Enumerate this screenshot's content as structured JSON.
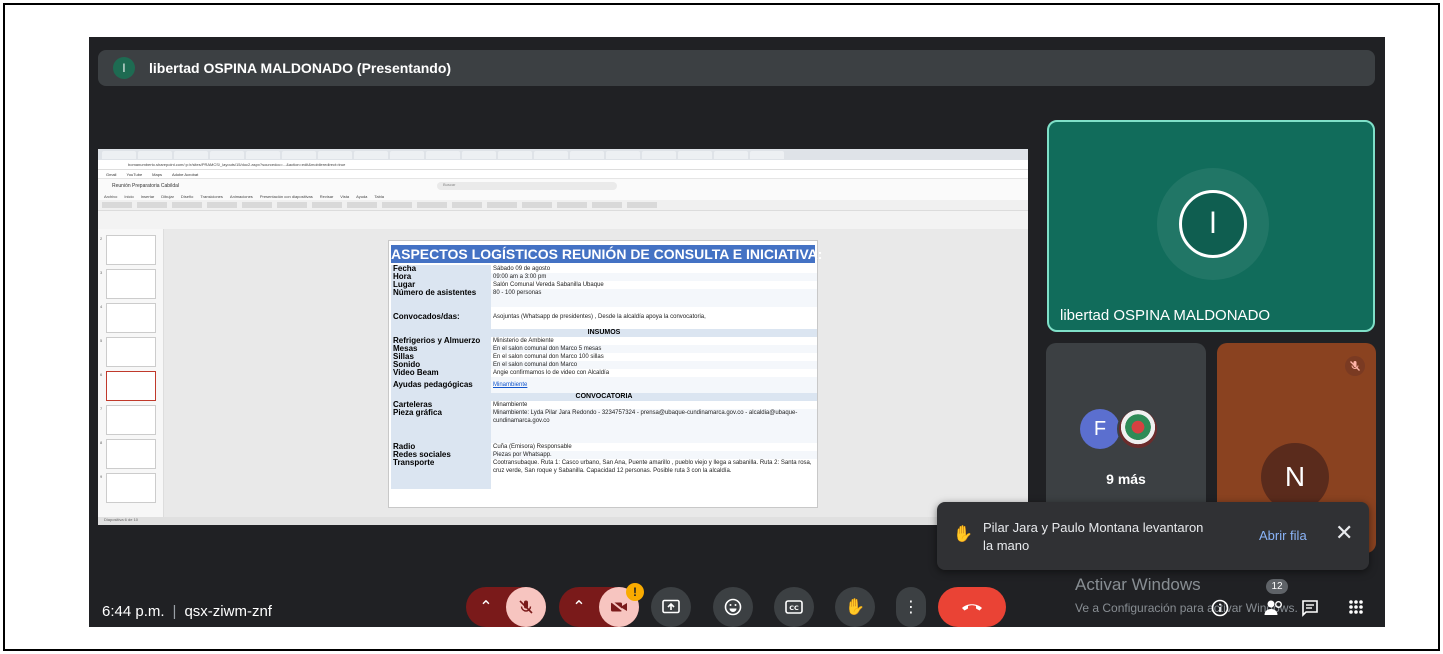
{
  "presenter_bar": {
    "initial": "l",
    "name": "libertad OSPINA MALDONADO (Presentando)"
  },
  "browser": {
    "url": "bomanumberto.sharepoint.com/:p:/r/sites/PRAMCS/_layouts/15/doc2.aspx?sourcedoc=...&action=edit&mobileredirect=true",
    "bookmarks": [
      "Gmail",
      "YouTube",
      "Maps",
      "Adobe Acrobat"
    ]
  },
  "powerpoint": {
    "file": "Reunión Preparatoria Cabildal",
    "search": "Buscar",
    "menu": [
      "Archivo",
      "Inicio",
      "Insertar",
      "Dibujar",
      "Diseño",
      "Transiciones",
      "Animaciones",
      "Presentación con diapositivas",
      "Revisar",
      "Vista",
      "Ayuda",
      "Tabla"
    ],
    "status": "Diapositiva 6 de 10"
  },
  "slide": {
    "title": "ASPECTOS LOGÍSTICOS REUNIÓN DE CONSULTA E INICIATIVA:",
    "rows1": [
      {
        "k": "Fecha",
        "v": "Sábado 09 de agosto"
      },
      {
        "k": "Hora",
        "v": "09:00 am a 3:00 pm"
      },
      {
        "k": "Lugar",
        "v": "Salón Comunal Vereda Sabanilla Ubaque"
      },
      {
        "k": "Número de asistentes",
        "v": "80 - 100 personas"
      },
      {
        "k": "Convocados/das:",
        "v": "Asojuntas (Whatsapp de presidentes) , Desde la alcaldía apoya la convocatoria,"
      }
    ],
    "sec1": "INSUMOS",
    "rows2": [
      {
        "k": "Refrigerios y Almuerzo",
        "v": "Ministerio de Ambiente"
      },
      {
        "k": "Mesas",
        "v": "En el salon comunal don Marco 5 mesas"
      },
      {
        "k": "Sillas",
        "v": "En el salon comunal don Marco 100 sillas"
      },
      {
        "k": "Sonido",
        "v": "En el salon comunal don Marco"
      },
      {
        "k": "Video Beam",
        "v": "Angie confirmamos lo de video con Alcaldía"
      },
      {
        "k": "Ayudas pedagógicas",
        "v": "Minambiente"
      }
    ],
    "sec2": "CONVOCATORIA",
    "rows3": [
      {
        "k": "Carteleras",
        "v": "Minambiente"
      },
      {
        "k": "Pieza gráfica",
        "v": "Minambiente: Lyda Pilar Jara Redondo - 3234757324 - prensa@ubaque-cundinamarca.gov.co - alcaldia@ubaque-cundinamarca.gov.co"
      },
      {
        "k": "Radio",
        "v": "Cuña (Emisora) Responsable"
      },
      {
        "k": "Redes sociales",
        "v": "Piezas por Whatsapp."
      },
      {
        "k": "Transporte",
        "v": "Cootransubaque. Ruta 1: Casco urbano, San Ana, Puente amarillo , pueblo viejo y llega a sabanilla. Ruta 2: Santa rosa, cruz verde, San roque y Sabanilla. Capacidad 12 personas. Posible ruta 3 con la alcaldía."
      }
    ]
  },
  "tiles": {
    "main": {
      "initial": "l",
      "name": "libertad OSPINA MALDONADO"
    },
    "more": {
      "initial": "F",
      "label": "9 más"
    },
    "n": {
      "initial": "N"
    }
  },
  "toast": {
    "message": "Pilar Jara y Paulo Montana levantaron la mano",
    "action": "Abrir fila"
  },
  "footer": {
    "time": "6:44 p.m.",
    "code": "qsx-ziwm-znf",
    "participants_count": "12",
    "warning": "!"
  },
  "watermark": {
    "line1": "Activar Windows",
    "line2": "Ve a Configuración para activar Windows."
  },
  "colors": {
    "background": "#202124",
    "accent_tile": "#116c5b",
    "end_call": "#ea4335",
    "link": "#8ab4f8"
  }
}
